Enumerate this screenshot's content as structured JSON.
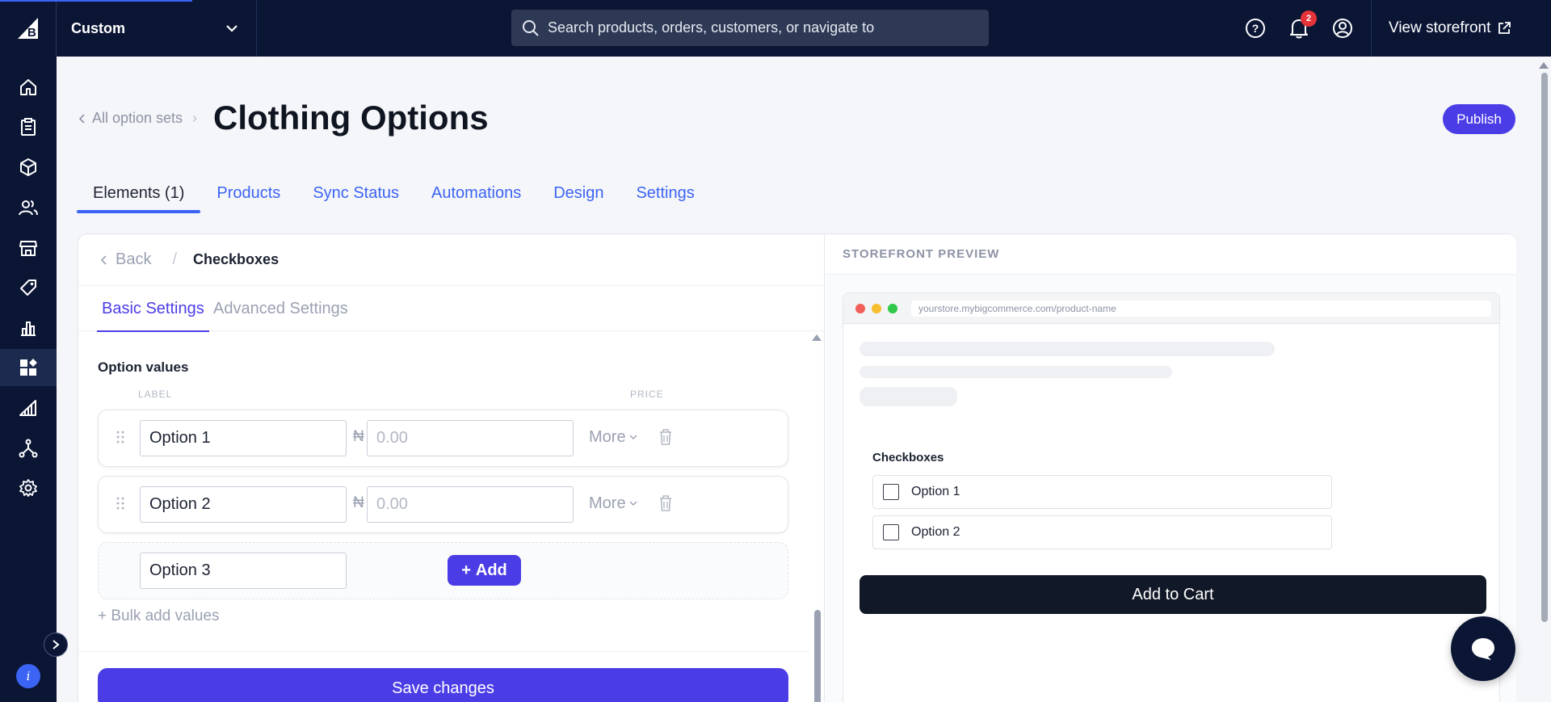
{
  "topbar": {
    "store_name": "Custom",
    "search_placeholder": "Search products, orders, customers, or navigate to",
    "notification_count": "2",
    "view_storefront": "View storefront"
  },
  "sidebar": {
    "items": [
      "home-icon",
      "orders-icon",
      "products-icon",
      "customers-icon",
      "storefront-icon",
      "marketing-icon",
      "analytics-icon",
      "apps-icon",
      "channels-icon",
      "integrations-icon",
      "settings-icon"
    ],
    "active": "apps-icon"
  },
  "header": {
    "breadcrumb": "All option sets",
    "title": "Clothing Options",
    "publish": "Publish"
  },
  "tabs": [
    "Elements (1)",
    "Products",
    "Sync Status",
    "Automations",
    "Design",
    "Settings"
  ],
  "editor": {
    "back": "Back",
    "crumb": "Checkboxes",
    "subtabs": [
      "Basic Settings",
      "Advanced Settings"
    ],
    "section_title": "Option values",
    "col_label": "LABEL",
    "col_price": "PRICE",
    "rows": [
      {
        "label": "Option 1",
        "currency": "₦",
        "price_placeholder": "0.00",
        "more": "More"
      },
      {
        "label": "Option 2",
        "currency": "₦",
        "price_placeholder": "0.00",
        "more": "More"
      }
    ],
    "new_value": "Option 3",
    "add": "Add",
    "bulk_add": "+ Bulk add values",
    "save": "Save changes"
  },
  "preview": {
    "title": "STOREFRONT PREVIEW",
    "url": "yourstore.mybigcommerce.com/product-name",
    "checkbox_title": "Checkboxes",
    "options": [
      "Option 1",
      "Option 2"
    ],
    "add_to_cart": "Add to Cart"
  },
  "colors": {
    "nav_bg": "#0b1635",
    "primary": "#4b3de6",
    "link": "#3c64f4",
    "badge": "#e5333a"
  }
}
